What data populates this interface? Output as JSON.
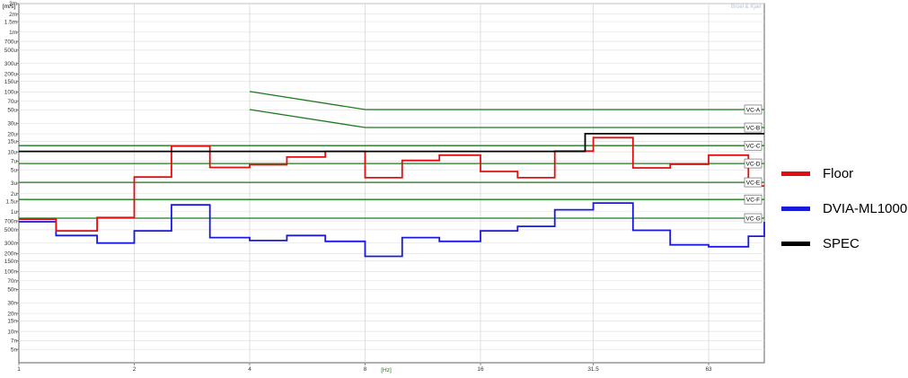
{
  "chart_data": {
    "type": "line",
    "step": true,
    "brand": "Brüel & Kjær",
    "ylabel": "[m/s]",
    "xlabel": "[Hz]",
    "xscale": "log",
    "yscale": "log",
    "xlim": [
      1,
      88
    ],
    "ylim": [
      3e-09,
      0.003
    ],
    "x_ticks": [
      {
        "v": 1,
        "label": "1"
      },
      {
        "v": 2,
        "label": "2"
      },
      {
        "v": 4,
        "label": "4"
      },
      {
        "v": 8,
        "label": "8"
      },
      {
        "v": 16,
        "label": "16"
      },
      {
        "v": 31.5,
        "label": "31.5"
      },
      {
        "v": 63,
        "label": "63"
      }
    ],
    "y_ticks": [
      {
        "v": 0.003,
        "label": "3m"
      },
      {
        "v": 0.002,
        "label": "2m"
      },
      {
        "v": 0.0015,
        "label": "1.5m"
      },
      {
        "v": 0.001,
        "label": "1m"
      },
      {
        "v": 0.0007,
        "label": "700u"
      },
      {
        "v": 0.0005,
        "label": "500u"
      },
      {
        "v": 0.0003,
        "label": "300u"
      },
      {
        "v": 0.0002,
        "label": "200u"
      },
      {
        "v": 0.00015,
        "label": "150u"
      },
      {
        "v": 0.0001,
        "label": "100u"
      },
      {
        "v": 7e-05,
        "label": "70u"
      },
      {
        "v": 5e-05,
        "label": "50u"
      },
      {
        "v": 3e-05,
        "label": "30u"
      },
      {
        "v": 2e-05,
        "label": "20u"
      },
      {
        "v": 1.5e-05,
        "label": "15u"
      },
      {
        "v": 1e-05,
        "label": "10u"
      },
      {
        "v": 7e-06,
        "label": "7u"
      },
      {
        "v": 5e-06,
        "label": "5u"
      },
      {
        "v": 3e-06,
        "label": "3u"
      },
      {
        "v": 2e-06,
        "label": "2u"
      },
      {
        "v": 1.5e-06,
        "label": "1.5u"
      },
      {
        "v": 1e-06,
        "label": "1u"
      },
      {
        "v": 7e-07,
        "label": "700n"
      },
      {
        "v": 5e-07,
        "label": "500n"
      },
      {
        "v": 3e-07,
        "label": "300n"
      },
      {
        "v": 2e-07,
        "label": "200n"
      },
      {
        "v": 1.5e-07,
        "label": "150n"
      },
      {
        "v": 1e-07,
        "label": "100n"
      },
      {
        "v": 7e-08,
        "label": "70n"
      },
      {
        "v": 5e-08,
        "label": "50n"
      },
      {
        "v": 3e-08,
        "label": "30n"
      },
      {
        "v": 2e-08,
        "label": "20n"
      },
      {
        "v": 1.5e-08,
        "label": "15n"
      },
      {
        "v": 1e-08,
        "label": "10n"
      },
      {
        "v": 7e-09,
        "label": "7n"
      },
      {
        "v": 5e-09,
        "label": "5n"
      }
    ],
    "bands": [
      1,
      1.25,
      1.6,
      2,
      2.5,
      3.15,
      4,
      5,
      6.3,
      8,
      10,
      12.5,
      16,
      20,
      25,
      31.5,
      40,
      50,
      63,
      80,
      88
    ],
    "series": [
      {
        "name": "Floor",
        "color": "#e01010",
        "values": [
          7.5e-07,
          4.8e-07,
          8e-07,
          3.8e-06,
          1.25e-05,
          5.5e-06,
          6.1e-06,
          8.2e-06,
          1.02e-05,
          3.7e-06,
          7.2e-06,
          8.8e-06,
          4.7e-06,
          3.7e-06,
          1.03e-05,
          1.73e-05,
          5.4e-06,
          6.2e-06,
          8.8e-06,
          2.7e-06
        ]
      },
      {
        "name": "DVIA-ML1000",
        "color": "#1a1adc",
        "values": [
          6.8e-07,
          4e-07,
          3e-07,
          4.8e-07,
          1.3e-06,
          3.7e-07,
          3.3e-07,
          4e-07,
          3.2e-07,
          1.8e-07,
          3.7e-07,
          3.2e-07,
          4.8e-07,
          5.7e-07,
          1.08e-06,
          1.4e-06,
          4.9e-07,
          2.8e-07,
          2.6e-07,
          3.9e-07,
          6.8e-07
        ]
      },
      {
        "name": "SPEC",
        "color": "#000000",
        "x": [
          1,
          30,
          88
        ],
        "values": [
          1.02e-05,
          2.01e-05,
          2.01e-05
        ]
      }
    ],
    "criteria": [
      {
        "label": "VC-A",
        "x": [
          4,
          8,
          88
        ],
        "y": [
          0.000102,
          5.1e-05,
          5.1e-05
        ]
      },
      {
        "label": "VC-B",
        "x": [
          4,
          8,
          88
        ],
        "y": [
          5.1e-05,
          2.55e-05,
          2.55e-05
        ]
      },
      {
        "label": "VC-C",
        "x": [
          1,
          88
        ],
        "y": [
          1.27e-05,
          1.27e-05
        ]
      },
      {
        "label": "VC-D",
        "x": [
          1,
          88
        ],
        "y": [
          6.4e-06,
          6.4e-06
        ]
      },
      {
        "label": "VC-E",
        "x": [
          1,
          88
        ],
        "y": [
          3.1e-06,
          3.1e-06
        ]
      },
      {
        "label": "VC-F",
        "x": [
          1,
          88
        ],
        "y": [
          1.6e-06,
          1.6e-06
        ]
      },
      {
        "label": "VC-G",
        "x": [
          1,
          88
        ],
        "y": [
          7.8e-07,
          7.8e-07
        ]
      }
    ],
    "criteria_color": "#1f7a1f",
    "legend_position": "right"
  }
}
